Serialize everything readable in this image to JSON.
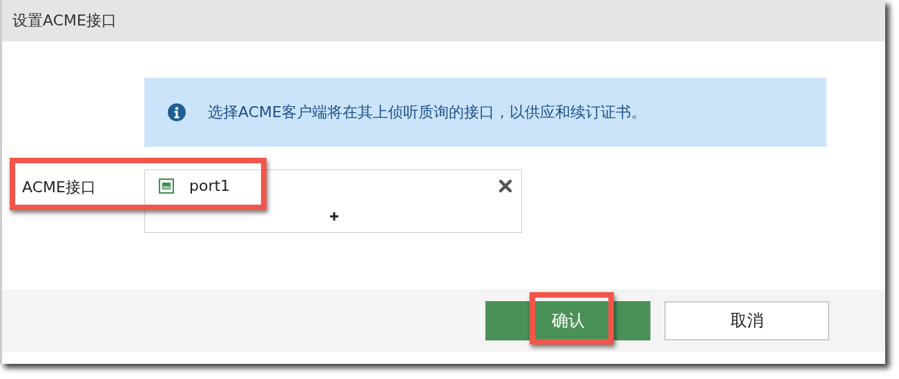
{
  "dialog": {
    "title": "设置ACME接口"
  },
  "info": {
    "message": "选择ACME客户端将在其上侦听质询的接口，以供应和续订证书。"
  },
  "field": {
    "label": "ACME接口",
    "highlighted": true,
    "values": [
      {
        "label": "port1"
      }
    ]
  },
  "buttons": [
    {
      "label": "确认",
      "kind": "primary",
      "highlighted": true
    },
    {
      "label": "取消",
      "kind": "secondary",
      "highlighted": false
    }
  ]
}
